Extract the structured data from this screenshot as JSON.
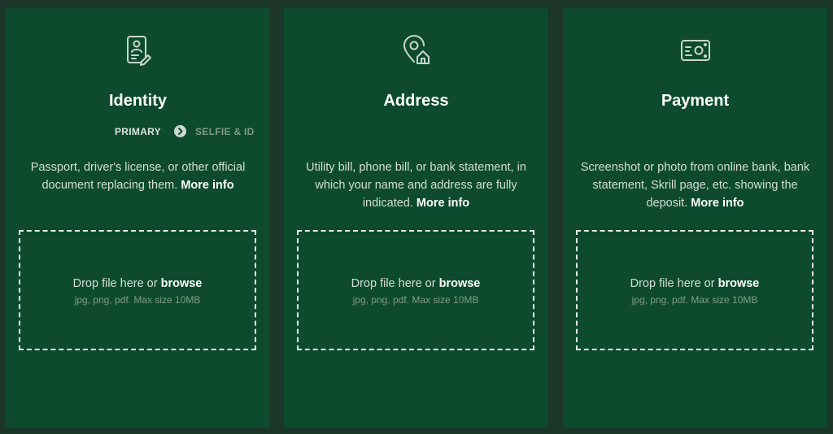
{
  "colors": {
    "page_background": "#1b3528",
    "card_background": "#0e4b2e",
    "text_primary": "#ffffff",
    "text_secondary": "#d3ddd7",
    "text_muted": "#7f9a8b"
  },
  "cards": [
    {
      "icon": "id-document-icon",
      "title": "Identity",
      "steps": {
        "primary": "PRIMARY",
        "arrow_icon": "chevron-right-circle-icon",
        "secondary": "SELFIE & ID"
      },
      "description": "Passport, driver's license, or other official document replacing them.",
      "more_info": "More info",
      "drop": {
        "text": "Drop file here or",
        "browse": "browse",
        "hint": "jpg, png, pdf. Max size 10MB"
      }
    },
    {
      "icon": "location-home-icon",
      "title": "Address",
      "description": "Utility bill, phone bill, or bank statement, in which your name and address are fully indicated.",
      "more_info": "More info",
      "drop": {
        "text": "Drop file here or",
        "browse": "browse",
        "hint": "jpg, png, pdf. Max size 10MB"
      }
    },
    {
      "icon": "payment-card-icon",
      "title": "Payment",
      "description": "Screenshot or photo from online bank, bank statement, Skrill page, etc. showing the deposit.",
      "more_info": "More info",
      "drop": {
        "text": "Drop file here or",
        "browse": "browse",
        "hint": "jpg, png, pdf. Max size 10MB"
      }
    }
  ]
}
